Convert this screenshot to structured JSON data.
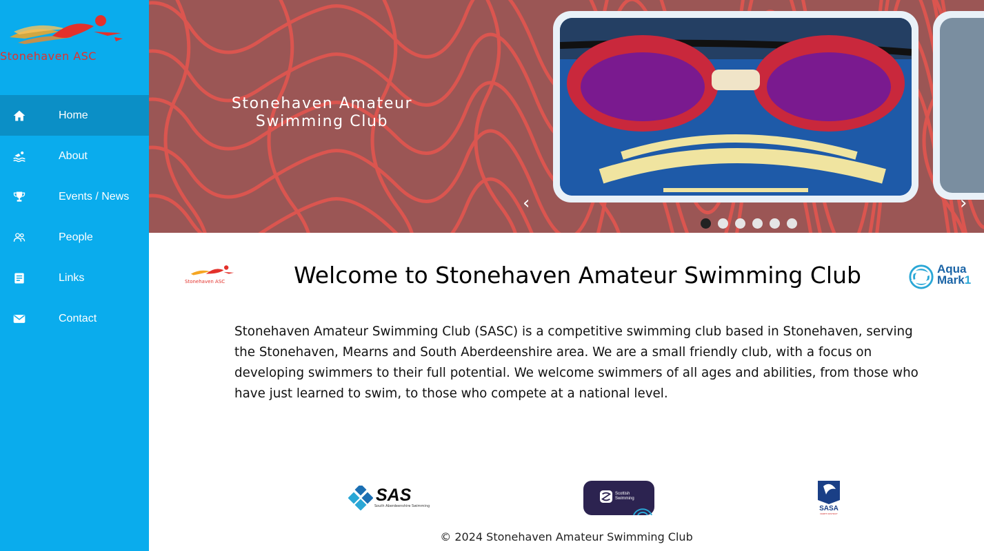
{
  "sidebar": {
    "brand": "Stonehaven ASC",
    "items": [
      {
        "label": "Home",
        "icon": "home-icon"
      },
      {
        "label": "About",
        "icon": "swimmer-icon"
      },
      {
        "label": "Events / News",
        "icon": "trophy-icon"
      },
      {
        "label": "People",
        "icon": "people-icon"
      },
      {
        "label": "Links",
        "icon": "document-icon"
      },
      {
        "label": "Contact",
        "icon": "mail-icon"
      }
    ],
    "active_item": "Home"
  },
  "hero": {
    "title_line1": "Stonehaven Amateur",
    "title_line2": "Swimming Club",
    "prev_arrow": "‹",
    "next_arrow": "›",
    "slide_count": 6,
    "active_slide": 1
  },
  "welcome": {
    "small_logo_text": "Stonehaven ASC",
    "heading": "Welcome to Stonehaven Amateur Swimming Club",
    "aquamark_line1": "Aqua",
    "aquamark_line2": "Mark",
    "aquamark_num": "1",
    "intro": "Stonehaven Amateur Swimming Club (SASC) is a competitive swimming club based in Stonehaven, serving the Stonehaven, Mearns and South Aberdeenshire area. We are a small friendly club, with a focus on developing swimmers to their full potential. We welcome swimmers of all ages and abilities, from those who have just learned to swim, to those who compete at a national level."
  },
  "sponsors": {
    "sas": "SAS",
    "sas_sub": "South Aberdeenshire Swimming",
    "scottish_line1": "Scottish",
    "scottish_line2": "Swimming",
    "sasa": "SASA",
    "sasa_sub": "NORTH DISTRICT"
  },
  "footer": {
    "copyright": "© 2024 Stonehaven Amateur Swimming Club"
  },
  "colors": {
    "sidebar_bg": "#0aaced",
    "sidebar_active": "#0b8fc6",
    "hero_bg": "#9b5655",
    "hero_wave": "#e2554f",
    "brand_red": "#e3312b"
  }
}
